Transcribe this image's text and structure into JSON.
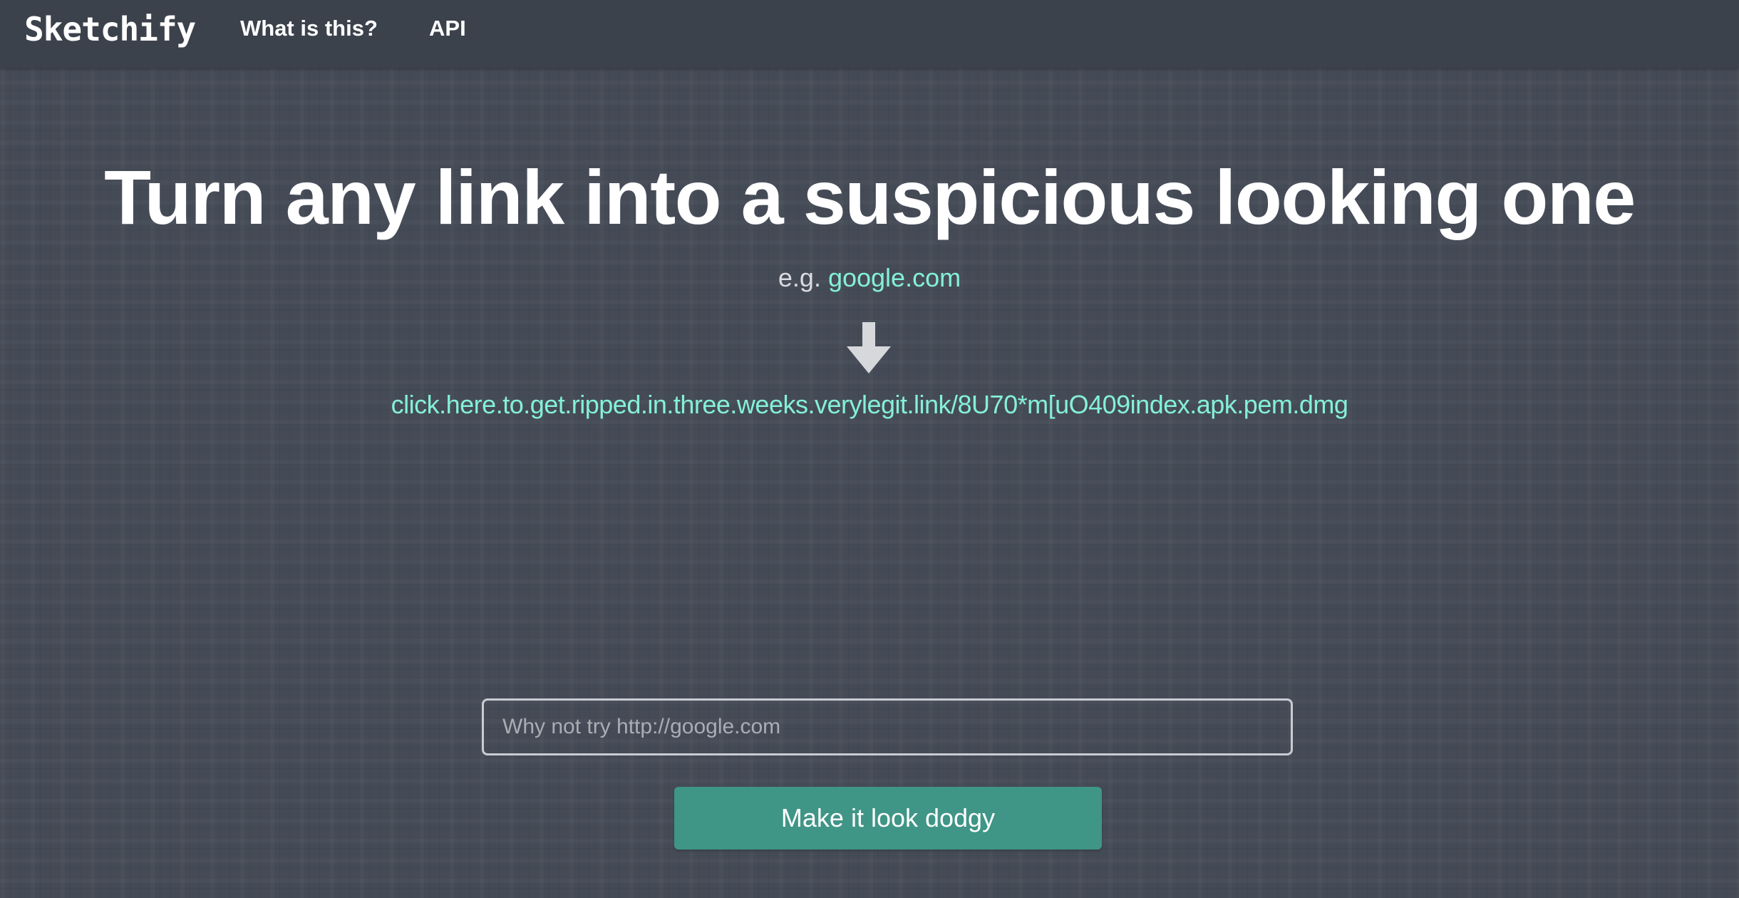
{
  "nav": {
    "brand": "Sketchify",
    "links": [
      {
        "label": "What is this?"
      },
      {
        "label": "API"
      }
    ]
  },
  "hero": {
    "title": "Turn any link into a suspicious looking one",
    "example_prefix": "e.g.",
    "example_link": "google.com",
    "arrow_icon": "arrow-down-icon",
    "dodgy_link": "click.here.to.get.ripped.in.three.weeks.verylegit.link/8U70*m[uO409index.apk.pem.dmg"
  },
  "form": {
    "input_placeholder": "Why not try http://google.com",
    "input_value": "",
    "submit_label": "Make it look dodgy"
  },
  "colors": {
    "background": "#454b56",
    "navbar": "#3c424c",
    "link_accent": "#84f0d8",
    "button": "#3f9586"
  }
}
